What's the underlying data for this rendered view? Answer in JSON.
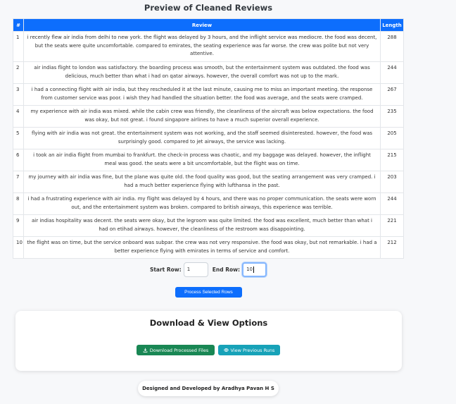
{
  "page_title": "Preview of Cleaned Reviews",
  "table": {
    "headers": [
      "#",
      "Review",
      "Length"
    ],
    "rows": [
      {
        "idx": "1",
        "review": "i recently flew air india from delhi to new york. the flight was delayed by 3 hours, and the inflight service was mediocre. the food was decent, but the seats were quite uncomfortable. compared to emirates, the seating experience was far worse. the crew was polite but not very attentive.",
        "length": "288"
      },
      {
        "idx": "2",
        "review": "air indias flight to london was satisfactory. the boarding process was smooth, but the entertainment system was outdated. the food was delicious, much better than what i had on qatar airways. however, the overall comfort was not up to the mark.",
        "length": "244"
      },
      {
        "idx": "3",
        "review": "i had a connecting flight with air india, but they rescheduled it at the last minute, causing me to miss an important meeting. the response from customer service was poor. i wish they had handled the situation better. the food was average, and the seats were cramped.",
        "length": "267"
      },
      {
        "idx": "4",
        "review": "my experience with air india was mixed. while the cabin crew was friendly, the cleanliness of the aircraft was below expectations. the food was okay, but not great. i found singapore airlines to have a much superior overall experience.",
        "length": "235"
      },
      {
        "idx": "5",
        "review": "flying with air india was not great. the entertainment system was not working, and the staff seemed disinterested. however, the food was surprisingly good. compared to jet airways, the service was lacking.",
        "length": "205"
      },
      {
        "idx": "6",
        "review": "i took an air india flight from mumbai to frankfurt. the check-in process was chaotic, and my baggage was delayed. however, the inflight meal was good. the seats were a bit uncomfortable, but the flight was on time.",
        "length": "215"
      },
      {
        "idx": "7",
        "review": "my journey with air india was fine, but the plane was quite old. the food quality was good, but the seating arrangement was very cramped. i had a much better experience flying with lufthansa in the past.",
        "length": "203"
      },
      {
        "idx": "8",
        "review": "i had a frustrating experience with air india. my flight was delayed by 4 hours, and there was no proper communication. the seats were worn out, and the entertainment system was broken. compared to british airways, this experience was terrible.",
        "length": "244"
      },
      {
        "idx": "9",
        "review": "air indias hospitality was decent. the seats were okay, but the legroom was quite limited. the food was excellent, much better than what i had on etihad airways. however, the cleanliness of the restroom was disappointing.",
        "length": "221"
      },
      {
        "idx": "10",
        "review": "the flight was on time, but the service onboard was subpar. the crew was not very responsive. the food was okay, but not remarkable. i had a better experience flying with emirates in terms of service and comfort.",
        "length": "212"
      }
    ]
  },
  "range": {
    "start_label": "Start Row:",
    "start_value": "1",
    "end_label": "End Row:",
    "end_value": "10"
  },
  "process_button": "Process Selected Rows",
  "download_card": {
    "title": "Download & View Options",
    "download_button": "Download Processed Files",
    "download_icon": "download-icon",
    "view_button": "View Previous Runs",
    "view_icon": "eye-icon"
  },
  "footer": "Designed and Developed by Aradhya Pavan H S",
  "colors": {
    "primary": "#0d6efd",
    "success": "#198754",
    "info": "#17a2b8"
  }
}
